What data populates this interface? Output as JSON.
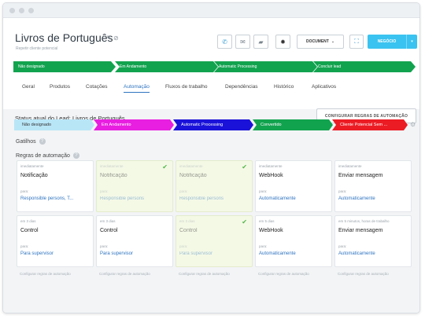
{
  "header": {
    "title": "Livros de Português",
    "subtitle": "Repetir cliente potencial",
    "document_label": "DOCUMENT",
    "negocio_label": "NEGÓCIO"
  },
  "stages": [
    "Não designado",
    "Em Andamento",
    "Automatic Processing",
    "Concluir lead"
  ],
  "tabs": [
    "Geral",
    "Produtos",
    "Cotações",
    "Automação",
    "Fluxos de trabalho",
    "Dependências",
    "Histórico",
    "Aplicativos"
  ],
  "active_tab": "Automação",
  "automation": {
    "status_title": "Status atual do Lead: Livros de Português",
    "configure_button": "CONFIGURAR REGRAS DE AUTOMAÇÃO",
    "gatilhos": "Gatilhos",
    "regras": "Regras de automação",
    "pipeline": [
      {
        "label": "Não designado",
        "color": "#b9e6f7",
        "text_color": "#333333"
      },
      {
        "label": "Em Andamento",
        "color": "#e81ee0",
        "text_color": "#ffffff"
      },
      {
        "label": "Automatic Processing",
        "color": "#1a12d9",
        "text_color": "#ffffff"
      },
      {
        "label": "Convertido",
        "color": "#12a34f",
        "text_color": "#ffffff"
      },
      {
        "label": "Cliente Potencial Sem ...",
        "color": "#ec1c24",
        "text_color": "#ffffff"
      }
    ],
    "row1": [
      {
        "when": "imediatamente",
        "name": "Notificação",
        "para": "para:",
        "target": "Responsible persons, T...",
        "faded": false
      },
      {
        "when": "imediatamente",
        "name": "Notificação",
        "para": "para:",
        "target": "Responsible persons",
        "faded": true
      },
      {
        "when": "imediatamente",
        "name": "Notificação",
        "para": "para:",
        "target": "Responsible persons",
        "faded": true
      },
      {
        "when": "imediatamente",
        "name": "WebHook",
        "para": "para:",
        "target": "Automaticamente",
        "faded": false
      },
      {
        "when": "imediatamente",
        "name": "Enviar mensagem",
        "para": "para:",
        "target": "Automaticamente",
        "faded": false
      }
    ],
    "row2": [
      {
        "when": "em 3 dias",
        "name": "Control",
        "para": "para:",
        "target": "Para supervisor",
        "faded": false
      },
      {
        "when": "em 3 dias",
        "name": "Control",
        "para": "para:",
        "target": "Para supervisor",
        "faded": false
      },
      {
        "when": "em 3 dias",
        "name": "Control",
        "para": "para:",
        "target": "Para supervisor",
        "faded": true
      },
      {
        "when": "em 5 dias",
        "name": "WebHook",
        "para": "para:",
        "target": "Automaticamente",
        "faded": false
      },
      {
        "when": "em 5 minutos, horas de trabalho",
        "name": "Enviar mensagem",
        "para": "para:",
        "target": "Automaticamente",
        "faded": false
      }
    ],
    "footer_link": "Configurar regras de automação"
  }
}
